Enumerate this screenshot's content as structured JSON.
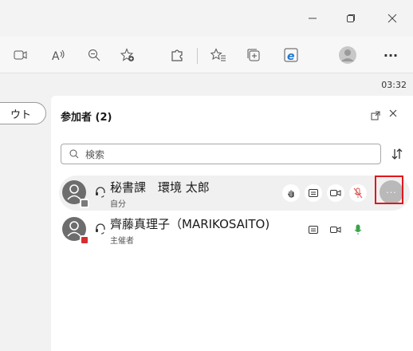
{
  "window": {
    "minimize_glyph": "–",
    "restore_glyph": "❐",
    "close_glyph": "✕"
  },
  "toolbar": {
    "icons": [
      "window-icon",
      "read-aloud-icon",
      "zoom-icon",
      "add-favorite-icon",
      "extensions-icon",
      "favorites-icon",
      "collections-icon",
      "ie-mode-icon",
      "profile-icon",
      "more-icon"
    ],
    "more_label": "···",
    "read_aloud_label": "A₅"
  },
  "meeting": {
    "clock": "03:32",
    "leave_label": "ウト"
  },
  "participants": {
    "title": "参加者 (2)",
    "search_placeholder": "検索",
    "items": [
      {
        "name": "秘書課　環境 太郎",
        "role": "自分",
        "badge_color": "#7a7a7a",
        "more_label": "···"
      },
      {
        "name": "齊藤真理子（MARIKOSAITO)",
        "role": "主催者",
        "badge_color": "#d32f2f"
      }
    ]
  },
  "colors": {
    "mute_red": "#d9534f",
    "mic_green": "#3aa34a",
    "highlight": "#e0171d"
  }
}
